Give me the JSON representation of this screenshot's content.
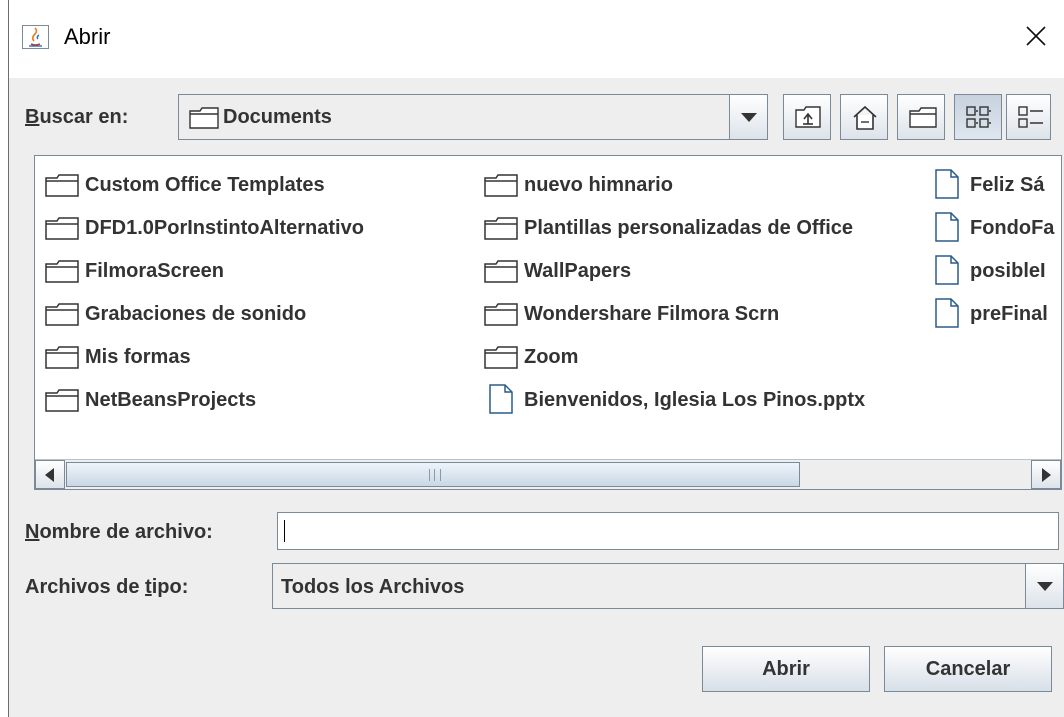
{
  "window": {
    "title": "Abrir"
  },
  "look_in": {
    "label_underlined": "B",
    "label_rest": "uscar en:",
    "value": "Documents"
  },
  "toolbar": {
    "buttons": [
      "up-one-level",
      "home",
      "new-folder",
      "list-view",
      "details-view"
    ]
  },
  "files": {
    "col1": [
      {
        "name": "Custom Office Templates",
        "icon": "folder-icon"
      },
      {
        "name": "DFD1.0PorInstintoAlternativo",
        "icon": "folder-icon"
      },
      {
        "name": "FilmoraScreen",
        "icon": "folder-icon"
      },
      {
        "name": "Grabaciones de sonido",
        "icon": "folder-icon"
      },
      {
        "name": "Mis formas",
        "icon": "folder-icon"
      },
      {
        "name": "NetBeansProjects",
        "icon": "folder-icon"
      }
    ],
    "col2": [
      {
        "name": "nuevo himnario",
        "icon": "folder-icon"
      },
      {
        "name": "Plantillas personalizadas de Office",
        "icon": "folder-icon"
      },
      {
        "name": "WallPapers",
        "icon": "folder-icon"
      },
      {
        "name": "Wondershare Filmora Scrn",
        "icon": "folder-icon"
      },
      {
        "name": "Zoom",
        "icon": "folder-icon"
      },
      {
        "name": "Bienvenidos, Iglesia Los Pinos.pptx",
        "icon": "file-icon"
      }
    ],
    "col3": [
      {
        "name": "Feliz Sá",
        "icon": "file-icon"
      },
      {
        "name": "FondoFa",
        "icon": "file-icon"
      },
      {
        "name": "posibleI",
        "icon": "file-icon"
      },
      {
        "name": "preFinal",
        "icon": "file-icon"
      }
    ]
  },
  "file_name": {
    "label_underlined": "N",
    "label_rest": "ombre de archivo:",
    "value": ""
  },
  "file_type": {
    "label_pre": "Archivos de ",
    "label_underlined": "t",
    "label_rest": "ipo:",
    "value": "Todos los Archivos"
  },
  "buttons": {
    "open": "Abrir",
    "cancel": "Cancelar"
  },
  "colors": {
    "border": "#7a8a99",
    "background": "#eeeeee",
    "text": "#333333"
  }
}
